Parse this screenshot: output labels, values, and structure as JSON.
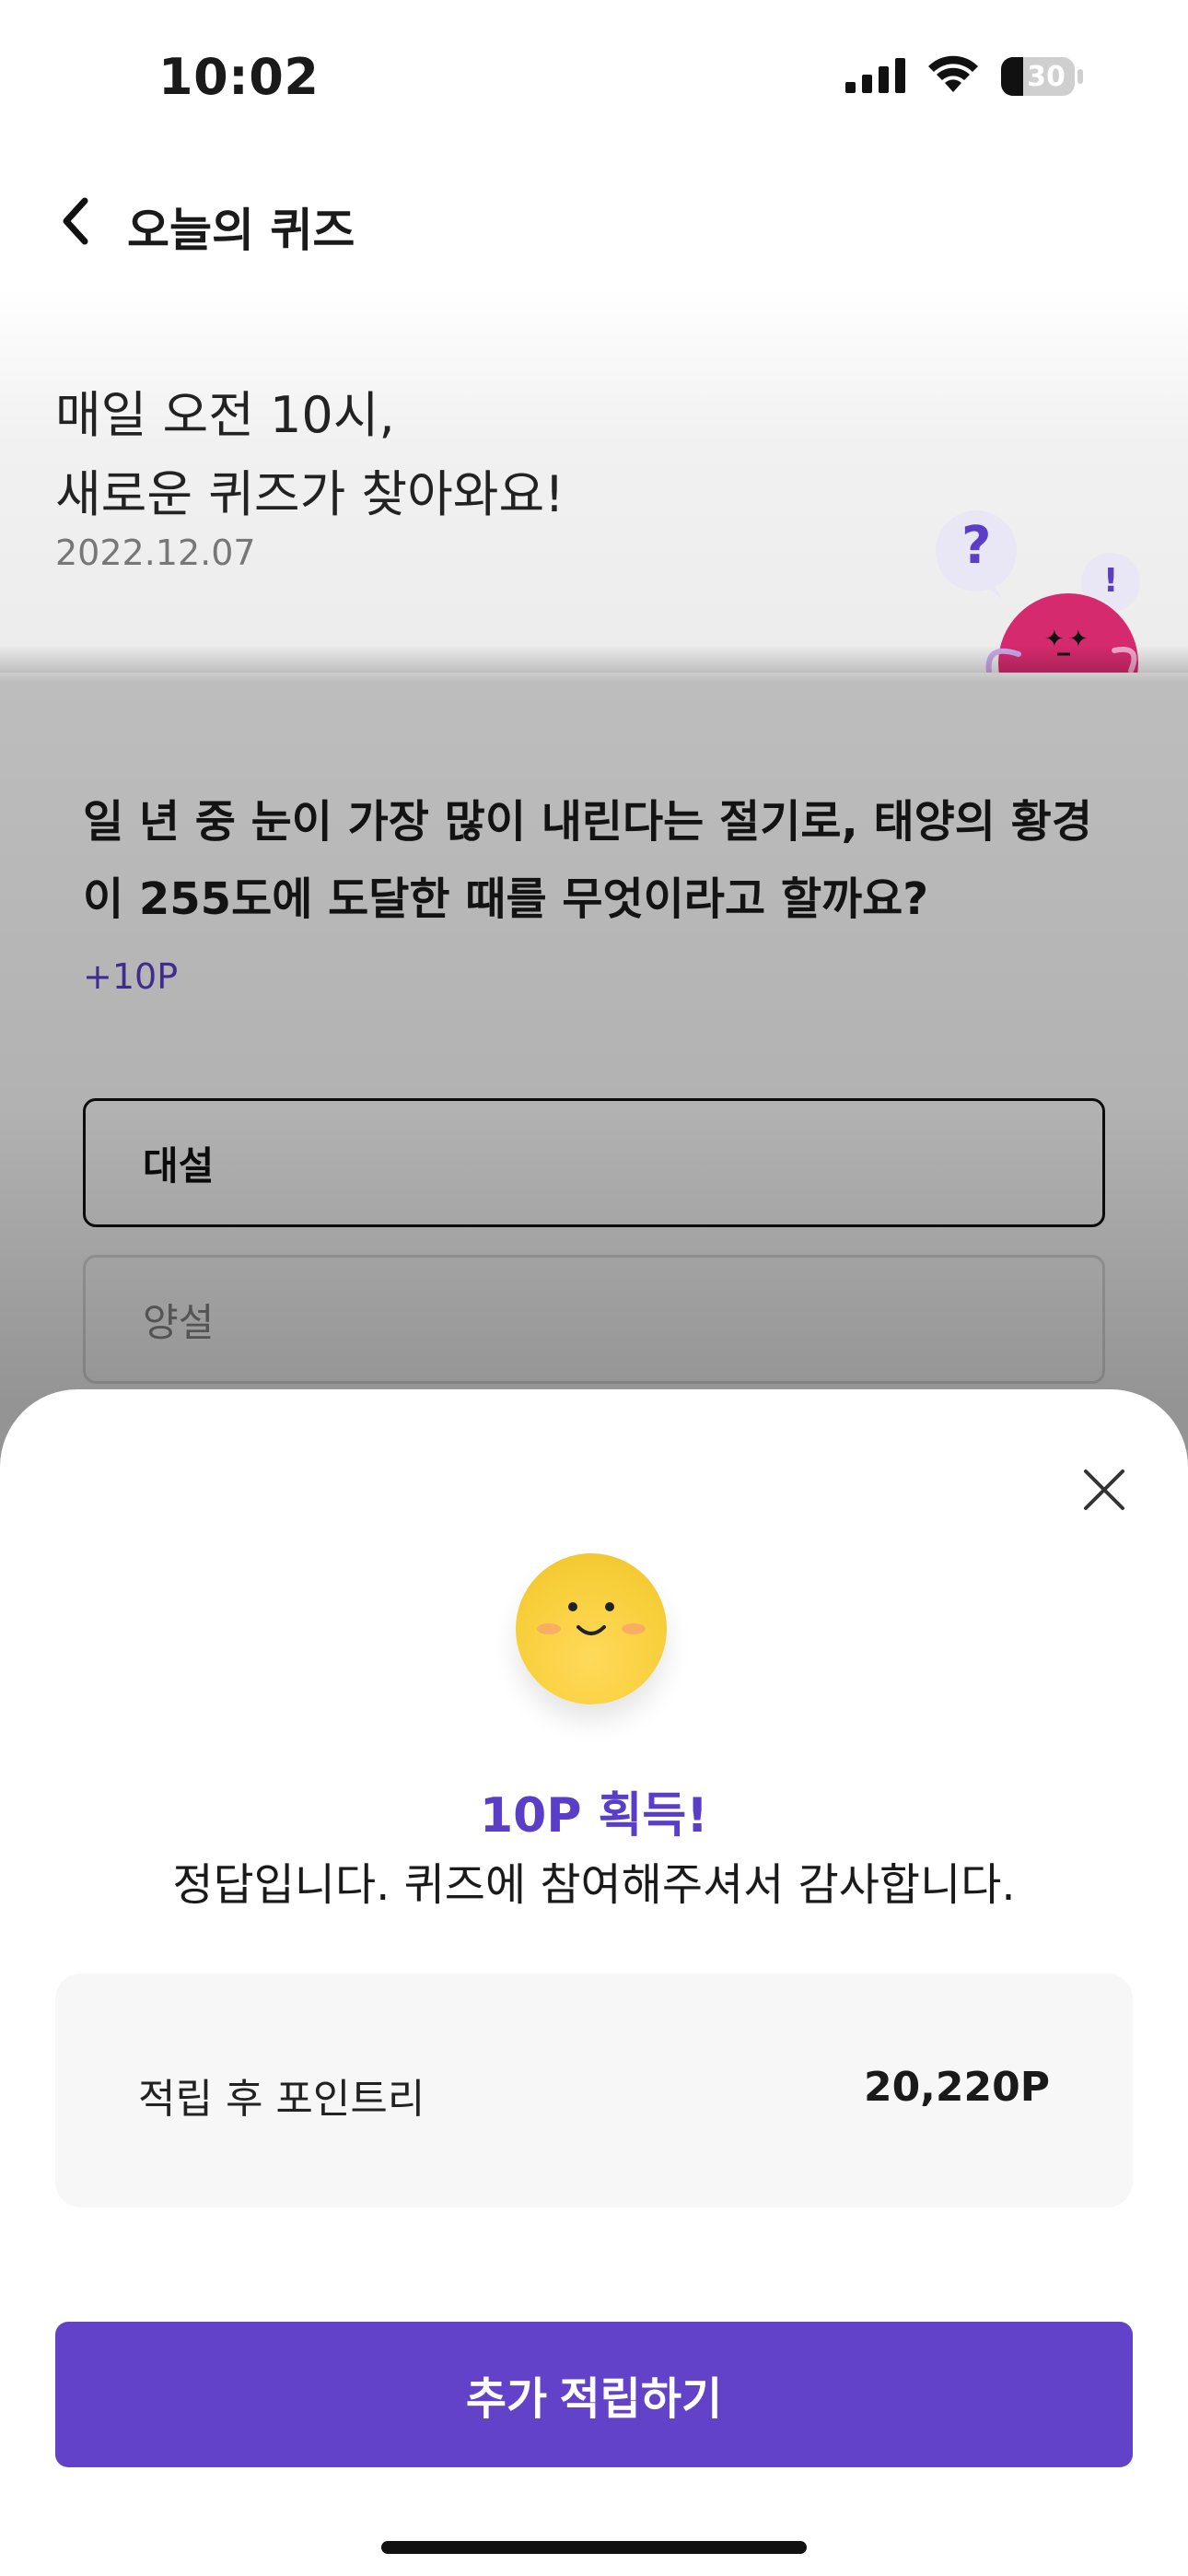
{
  "status_bar": {
    "time": "10:02",
    "battery": "30",
    "icons": [
      "signal-icon",
      "wifi-icon",
      "battery-icon"
    ]
  },
  "nav": {
    "title": "오늘의 퀴즈",
    "back_icon": "chevron-left-icon"
  },
  "hero": {
    "line1": "매일 오전 10시,",
    "line2": "새로운 퀴즈가 찾아와요!",
    "date": "2022.12.07",
    "mascot_bubbles": [
      "?",
      "!"
    ]
  },
  "quiz": {
    "question": "일 년 중 눈이 가장 많이 내린다는 절기로, 태양의 황경이 255도에 도달한 때를 무엇이라고 할까요?",
    "reward": "+10P",
    "options": [
      {
        "label": "대설",
        "selected": true
      },
      {
        "label": "양설",
        "selected": false
      }
    ]
  },
  "result_sheet": {
    "close_icon": "close-icon",
    "face_icon": "smile-face-icon",
    "title": "10P 획득!",
    "message": "정답입니다. 퀴즈에 참여해주셔서 감사합니다.",
    "points_label": "적립 후 포인트리",
    "points_value": "20,220P",
    "cta_label": "추가 적립하기"
  },
  "colors": {
    "accent": "#6242C9",
    "accent_text": "#5A3EC8",
    "face": "#F7CF3A",
    "mascot": "#D62A6E",
    "points_box": "#F7F7F7"
  }
}
